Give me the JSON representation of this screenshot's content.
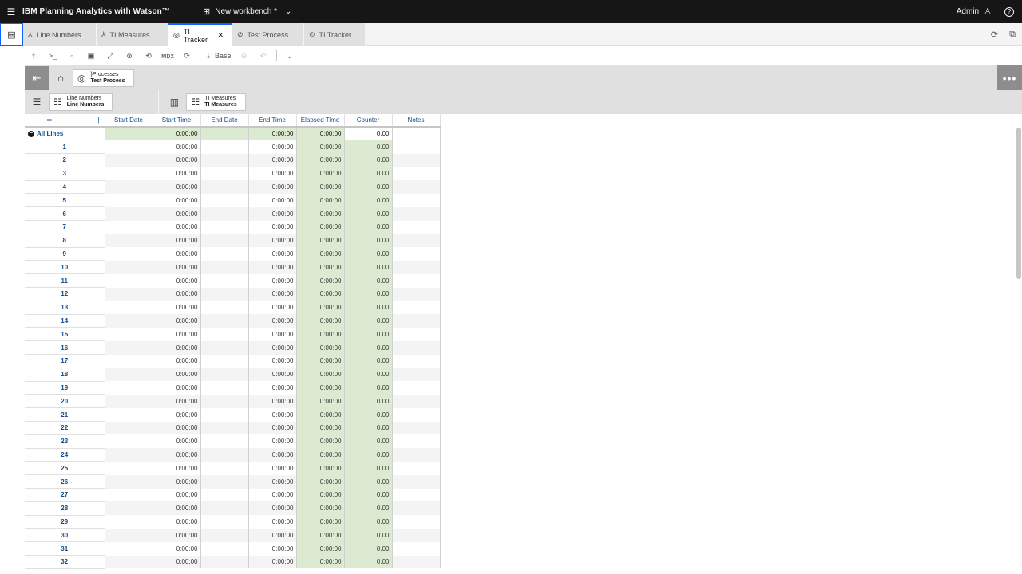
{
  "header": {
    "app_title": "IBM Planning Analytics with Watson™",
    "workbench_name": "New workbench *",
    "user": "Admin"
  },
  "tabs": [
    {
      "label": "Line Numbers",
      "icon": "dimension-icon",
      "active": false
    },
    {
      "label": "TI Measures",
      "icon": "dimension-icon",
      "active": false
    },
    {
      "label": "TI Tracker",
      "icon": "cube-icon",
      "active": true
    },
    {
      "label": "Test Process",
      "icon": "process-icon",
      "active": false
    },
    {
      "label": "TI Tracker",
      "icon": "cube-icon",
      "active": false
    }
  ],
  "toolbar": {
    "base_label": "Base"
  },
  "context": {
    "chip_dimension": "}Processes",
    "chip_member": "Test Process"
  },
  "rows_dim": {
    "dimension": "Line Numbers",
    "hierarchy": "Line Numbers"
  },
  "cols_dim": {
    "dimension": "TI Measures",
    "hierarchy": "TI Measures"
  },
  "grid": {
    "columns": [
      "Start Date",
      "Start Time",
      "End Date",
      "End Time",
      "Elapsed Time",
      "Counter",
      "Notes"
    ],
    "total_row": {
      "label": "All Lines",
      "start_time": "0:00:00",
      "end_time": "0:00:00",
      "elapsed": "0:00:00",
      "counter": "0.00"
    },
    "row_labels": [
      "1",
      "2",
      "3",
      "4",
      "5",
      "6",
      "7",
      "8",
      "9",
      "10",
      "11",
      "12",
      "13",
      "14",
      "15",
      "16",
      "17",
      "18",
      "19",
      "20",
      "21",
      "22",
      "23",
      "24",
      "25",
      "26",
      "27",
      "28",
      "29",
      "30",
      "31",
      "32"
    ],
    "time_value": "0:00:00",
    "counter_value": "0.00"
  },
  "colors": {
    "header_bg": "#161616",
    "accent": "#0f62fe",
    "calc_cell": "#dbead1"
  }
}
